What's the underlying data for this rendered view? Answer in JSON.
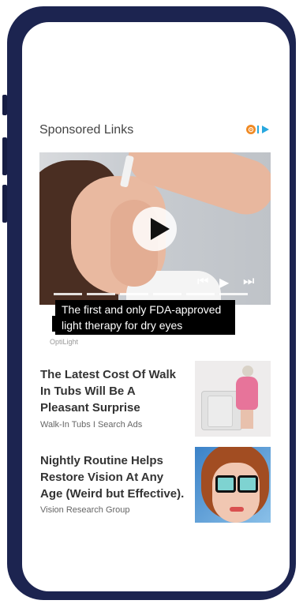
{
  "header": {
    "title": "Sponsored Links"
  },
  "adchoices": {
    "icon": "adchoices-icon",
    "colors": {
      "orange": "#f08a24",
      "blue": "#29a8df"
    }
  },
  "video_ad": {
    "caption_line1": "The first and only FDA-approved",
    "caption_line2": "light therapy for dry eyes",
    "brand": "OptiLight",
    "controls": [
      "previous-icon",
      "play-icon",
      "next-icon"
    ]
  },
  "items": [
    {
      "title_lines": [
        "The Latest Cost Of Walk",
        "In Tubs Will Be A",
        "Pleasant Surprise"
      ],
      "source": "Walk-In Tubs I Search Ads",
      "thumb": "walk-in-tub-photo"
    },
    {
      "title_lines": [
        "Nightly Routine Helps",
        "Restore Vision At Any",
        "Age (Weird but Effective)."
      ],
      "source": "Vision Research Group",
      "thumb": "cartoon-woman-glasses"
    }
  ],
  "colors": {
    "phone_frame": "#1c2450",
    "title_text": "#333333",
    "source_text": "#666666"
  }
}
